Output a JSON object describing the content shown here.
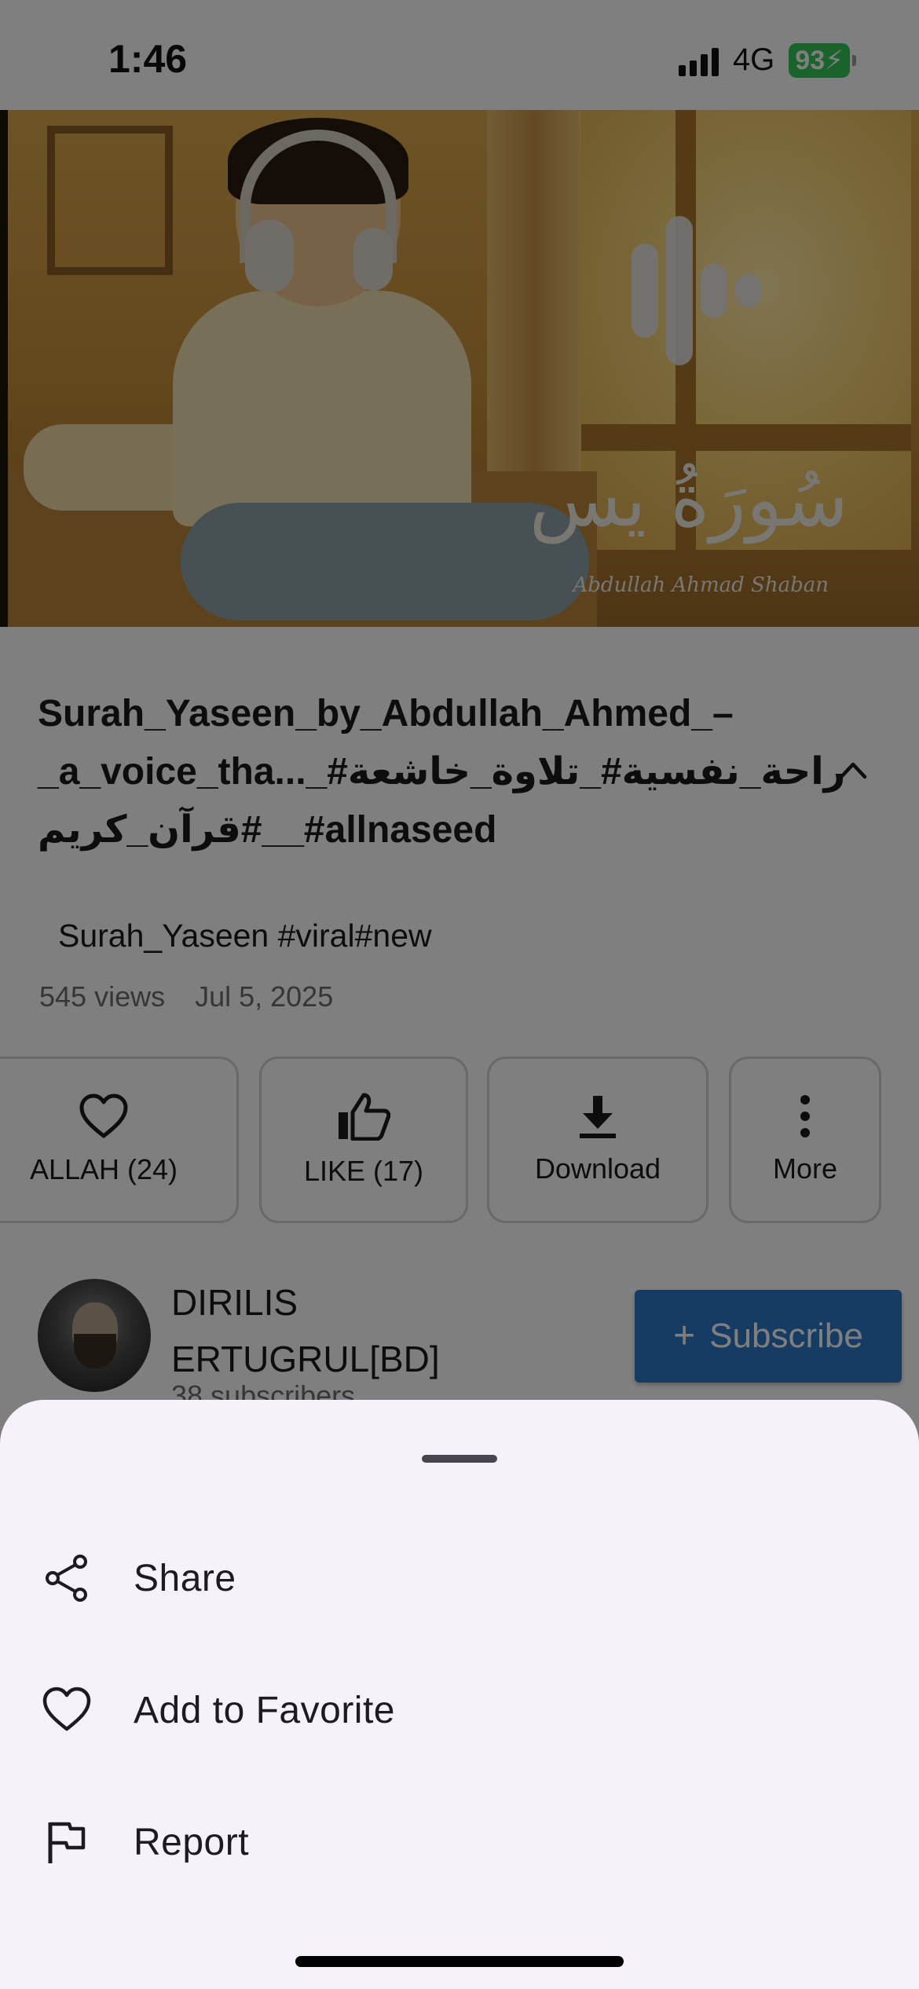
{
  "status_bar": {
    "time": "1:46",
    "network": "4G",
    "battery": "93"
  },
  "video": {
    "thumbnail_title": "سُورَةُ يس",
    "thumbnail_credit": "Abdullah Ahmad Shaban",
    "title_line1": "Surah_Yaseen_by_Abdullah_Ahmed_–",
    "title_line2": "_a_voice_tha..._#راحة_نفسية#_تلاوة_خاشعة",
    "title_line3": "قرآن_كريم#__#allnaseed",
    "description": "Surah_Yaseen #viral#new",
    "views": "545 views",
    "date": "Jul 5, 2025"
  },
  "actions": [
    {
      "label": "ALLAH (24)",
      "icon": "heart-outline-icon"
    },
    {
      "label": "LIKE (17)",
      "icon": "thumbs-up-icon"
    },
    {
      "label": "Download",
      "icon": "download-icon"
    },
    {
      "label": "More",
      "icon": "more-vertical-icon"
    }
  ],
  "channel": {
    "name": "DIRILIS ERTUGRUL[BD]",
    "subscribers": "38 subscribers",
    "subscribe_label": "Subscribe"
  },
  "sheet": {
    "items": [
      {
        "label": "Share",
        "icon": "share-icon"
      },
      {
        "label": "Add to Favorite",
        "icon": "heart-outline-icon"
      },
      {
        "label": "Report",
        "icon": "flag-icon"
      }
    ]
  },
  "colors": {
    "subscribe": "#2d78c7",
    "sheet_background": "#f7f2f9",
    "battery": "#34c759"
  }
}
